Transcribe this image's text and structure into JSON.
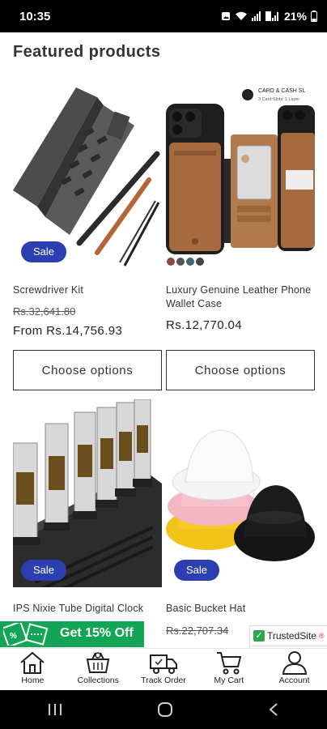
{
  "status_bar": {
    "time": "10:35",
    "battery": "21%"
  },
  "section": {
    "title": "Featured products"
  },
  "products": [
    {
      "name": "Screwdriver Kit",
      "badge": "Sale",
      "price_old": "Rs.32,641.80",
      "price": "From Rs.14,756.93",
      "button": "Choose options"
    },
    {
      "name": "Luxury Genuine Leather Phone Wallet Case",
      "image_text_1": "CARD & CASH SL",
      "image_text_2": "3 Card Slots' 1 Layer",
      "price": "Rs.12,770.04",
      "button": "Choose options"
    },
    {
      "name": "IPS Nixie Tube Digital Clock",
      "badge": "Sale"
    },
    {
      "name": "Basic Bucket Hat",
      "badge": "Sale",
      "price_old": "Rs.22,707.34"
    }
  ],
  "promo": {
    "label": "Get 15% Off"
  },
  "trusted": {
    "label": "TrustedSite",
    "mark": "®"
  },
  "nav": {
    "items": [
      {
        "label": "Home",
        "icon": "home-icon"
      },
      {
        "label": "Collections",
        "icon": "basket-icon"
      },
      {
        "label": "Track Order",
        "icon": "truck-icon"
      },
      {
        "label": "My Cart",
        "icon": "cart-icon"
      },
      {
        "label": "Account",
        "icon": "user-icon"
      }
    ]
  },
  "system_nav": {
    "icons": [
      "recents-icon",
      "home-circle-icon",
      "back-icon"
    ]
  },
  "colors": {
    "sale_badge": "#2c3fb1",
    "promo": "#13a556",
    "trusted_check": "#2ca84a"
  }
}
